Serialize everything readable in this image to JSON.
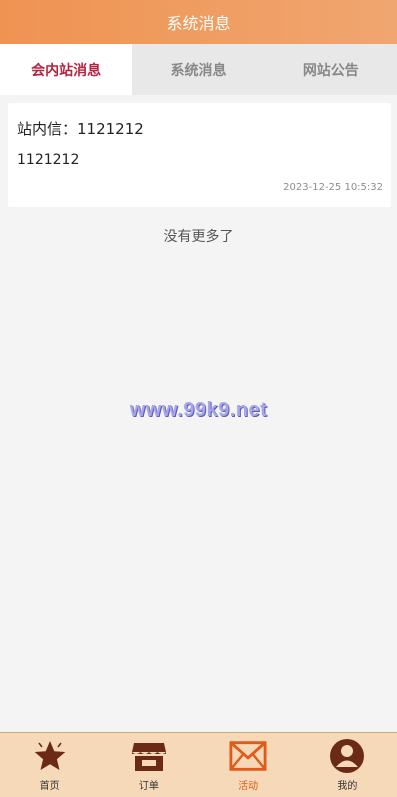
{
  "header": {
    "title": "系统消息"
  },
  "tabs": [
    {
      "label": "会内站消息",
      "active": true
    },
    {
      "label": "系统消息",
      "active": false
    },
    {
      "label": "网站公告",
      "active": false
    }
  ],
  "messages": [
    {
      "title": "站内信：1121212",
      "body": "1121212",
      "time": "2023-12-25 10:5:32"
    }
  ],
  "list_end_text": "没有更多了",
  "watermark": "www.99k9.net",
  "tabbar": {
    "items": [
      {
        "label": "首页",
        "icon": "star-icon"
      },
      {
        "label": "订单",
        "icon": "store-icon"
      },
      {
        "label": "活动",
        "icon": "mail-icon",
        "active": true
      },
      {
        "label": "我的",
        "icon": "user-icon"
      }
    ]
  },
  "colors": {
    "header_gradient_start": "#ef9352",
    "header_gradient_end": "#f0a670",
    "active_tab_text": "#b5233f",
    "tabbar_background": "#f6d9b8",
    "tabbar_icon": "#6b2a16",
    "tabbar_active": "#e05a1a"
  }
}
